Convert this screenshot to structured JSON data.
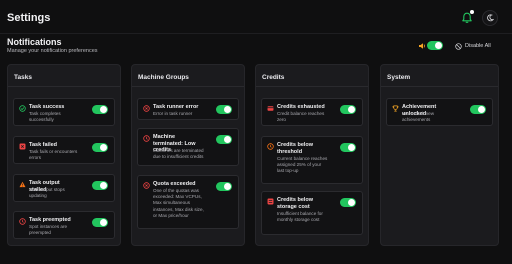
{
  "header": {
    "title": "Settings"
  },
  "notifications": {
    "title": "Notifications",
    "subtitle": "Manage your notification preferences",
    "disable_all": "Disable All",
    "enabled": true
  },
  "colors": {
    "accent": "#22c55e",
    "danger": "#ef4444",
    "warning": "#f97316",
    "success": "#22c55e",
    "gold": "#f5a524"
  },
  "columns": [
    {
      "title": "Tasks",
      "cards": [
        {
          "title": "Task success",
          "desc": "Task completes successfully",
          "icon": "check-circle-icon",
          "enabled": true
        },
        {
          "title": "Task failed",
          "desc": "Task fails or encounters errors",
          "icon": "x-square-icon",
          "enabled": true
        },
        {
          "title": "Task output stalled",
          "desc": "Task output stops updating",
          "icon": "warning-triangle-icon",
          "enabled": true
        },
        {
          "title": "Task preempted",
          "desc": "Spot instances are preempted",
          "icon": "clock-icon",
          "enabled": true
        }
      ]
    },
    {
      "title": "Machine Groups",
      "cards": [
        {
          "title": "Task runner error",
          "desc": "Error in task runner",
          "icon": "x-circle-icon",
          "enabled": true
        },
        {
          "title": "Machine terminated: Low credits",
          "desc": "Machines are terminated due to insufficient credits",
          "icon": "clock-icon",
          "enabled": true
        },
        {
          "title": "Quota exceeded",
          "desc": "One of the quotas was exceeded: Max VCPUs, Max simultaneous instances, Max disk size, or Max price/hour",
          "icon": "x-circle-icon",
          "enabled": true
        }
      ]
    },
    {
      "title": "Credits",
      "cards": [
        {
          "title": "Credits exhausted",
          "desc": "Credit balance reaches zero",
          "icon": "credit-card-icon",
          "enabled": true
        },
        {
          "title": "Credits below threshold",
          "desc": "Current balance reaches assigned 25% of your last top-up",
          "icon": "clock-icon",
          "enabled": true
        },
        {
          "title": "Credits below storage cost",
          "desc": "Insufficient balance for monthly storage cost",
          "icon": "database-icon",
          "enabled": true
        }
      ]
    },
    {
      "title": "System",
      "cards": [
        {
          "title": "Achievement unlocked",
          "desc": "You unlock new achievements",
          "icon": "trophy-icon",
          "enabled": true
        }
      ]
    }
  ]
}
